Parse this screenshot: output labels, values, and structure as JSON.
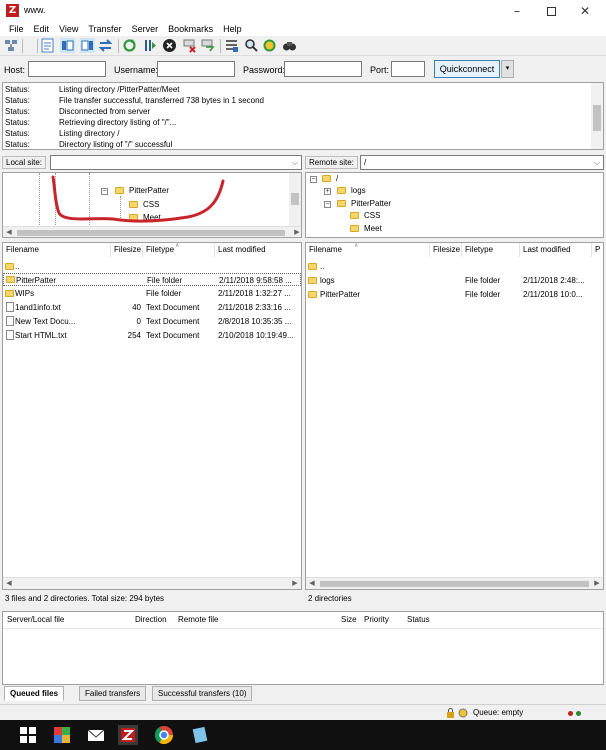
{
  "window": {
    "title": "www.",
    "app_icon_letter": "Z"
  },
  "menu": [
    "File",
    "Edit",
    "View",
    "Transfer",
    "Server",
    "Bookmarks",
    "Help"
  ],
  "toolbar_icons": [
    "site-manager-icon",
    "toggle-log-icon",
    "toggle-local-tree-icon",
    "toggle-remote-tree-icon",
    "toggle-queue-icon",
    "refresh-icon",
    "process-queue-icon",
    "cancel-icon",
    "disconnect-icon",
    "reconnect-icon",
    "filter-icon",
    "toggle-compare-icon",
    "sync-browse-icon",
    "search-icon"
  ],
  "quickconnect": {
    "host_label": "Host:",
    "username_label": "Username:",
    "password_label": "Password:",
    "port_label": "Port:",
    "button": "Quickconnect",
    "dropdown": "▾"
  },
  "log": [
    {
      "status": "Status:",
      "message": "Listing directory /PitterPatter/Meet"
    },
    {
      "status": "Status:",
      "message": "File transfer successful, transferred 738 bytes in 1 second"
    },
    {
      "status": "Status:",
      "message": "Disconnected from server"
    },
    {
      "status": "Status:",
      "message": "Retrieving directory listing of \"/\"..."
    },
    {
      "status": "Status:",
      "message": "Listing directory /"
    },
    {
      "status": "Status:",
      "message": "Directory listing of \"/\" successful"
    }
  ],
  "local": {
    "site_label": "Local site:",
    "site_value": "",
    "tree": [
      "PitterPatter",
      "CSS",
      "Meet"
    ],
    "columns": [
      "Filename",
      "Filesize",
      "Filetype",
      "Last modified"
    ],
    "rows": [
      {
        "name": "..",
        "size": "",
        "type": "",
        "modified": "",
        "icon": "folder"
      },
      {
        "name": "PitterPatter",
        "size": "",
        "type": "File folder",
        "modified": "2/11/2018 9:58:58 ...",
        "icon": "folder"
      },
      {
        "name": "WIPs",
        "size": "",
        "type": "File folder",
        "modified": "2/11/2018 1:32:27 ...",
        "icon": "folder"
      },
      {
        "name": "1and1info.txt",
        "size": "40",
        "type": "Text Document",
        "modified": "2/11/2018 2:33:16 ...",
        "icon": "file"
      },
      {
        "name": "New Text Docu...",
        "size": "0",
        "type": "Text Document",
        "modified": "2/8/2018 10:35:35 ...",
        "icon": "file"
      },
      {
        "name": "Start HTML.txt",
        "size": "254",
        "type": "Text Document",
        "modified": "2/10/2018 10:19:49...",
        "icon": "file"
      }
    ],
    "status": "3 files and 2 directories. Total size: 294 bytes"
  },
  "remote": {
    "site_label": "Remote site:",
    "site_value": "/",
    "tree": [
      "/",
      "logs",
      "PitterPatter",
      "CSS",
      "Meet"
    ],
    "columns": [
      "Filename",
      "Filesize",
      "Filetype",
      "Last modified",
      "P"
    ],
    "rows": [
      {
        "name": "..",
        "size": "",
        "type": "",
        "modified": "",
        "icon": "folder"
      },
      {
        "name": "logs",
        "size": "",
        "type": "File folder",
        "modified": "2/11/2018 2:48:...",
        "icon": "folder"
      },
      {
        "name": "PitterPatter",
        "size": "",
        "type": "File folder",
        "modified": "2/11/2018 10:0...",
        "icon": "folder"
      }
    ],
    "status": "2 directories"
  },
  "queue": {
    "columns": [
      "Server/Local file",
      "Direction",
      "Remote file",
      "Size",
      "Priority",
      "Status"
    ],
    "tabs": [
      "Queued files",
      "Failed transfers",
      "Successful transfers (10)"
    ],
    "status": "Queue: empty"
  },
  "colors": {
    "annotation": "#c8242b",
    "folder": "#f6d56b",
    "accent": "#3c7fb1"
  }
}
